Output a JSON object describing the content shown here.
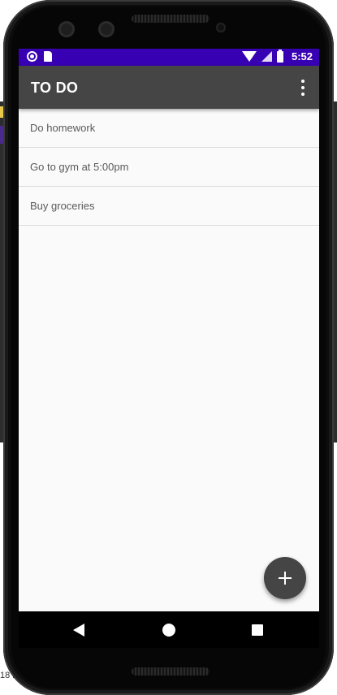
{
  "status_bar": {
    "time": "5:52",
    "background_color": "#3700b3",
    "left_icons": [
      "notification-circle-icon",
      "sd-card-icon"
    ],
    "right_icons": [
      "wifi-icon",
      "cell-signal-icon",
      "battery-icon"
    ]
  },
  "app_bar": {
    "title": "TO DO",
    "menu_icon": "overflow-menu-icon",
    "background_color": "#454545"
  },
  "todos": [
    {
      "text": "Do homework"
    },
    {
      "text": "Go to gym at 5:00pm"
    },
    {
      "text": "Buy groceries"
    }
  ],
  "fab": {
    "icon": "plus-icon"
  },
  "nav_bar": {
    "icons": [
      "back-icon",
      "home-icon",
      "recents-icon"
    ]
  },
  "background_window": {
    "bottom_text": "18 i"
  }
}
